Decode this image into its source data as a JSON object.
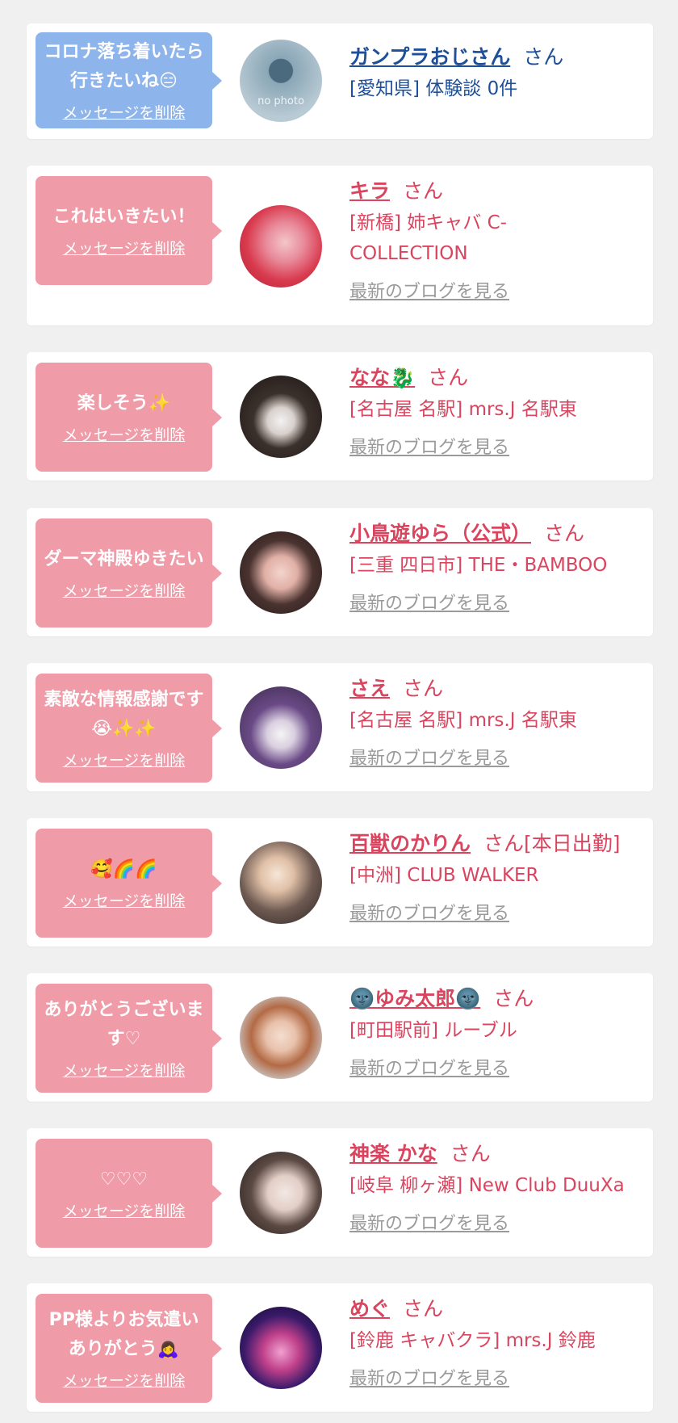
{
  "entries": [
    {
      "message": "コロナ落ち着いたら行きたいね😑",
      "delete_label": "メッセージを削除",
      "name": "ガンプラおじさん",
      "suffix": "さん",
      "detail": "[愛知県] 体験談 0件",
      "avatar_text": "no photo",
      "theme_color": "#8eb4ec"
    },
    {
      "message": "これはいきたい！",
      "delete_label": "メッセージを削除",
      "name": "キラ",
      "suffix": "さん",
      "detail": "[新橋] 姉キャバ C-COLLECTION",
      "blog_label": "最新のブログを見る",
      "theme_color": "#ef9ba8"
    },
    {
      "message": "楽しそう✨",
      "delete_label": "メッセージを削除",
      "name": "なな🐉",
      "suffix": "さん",
      "detail": "[名古屋 名駅] mrs.J 名駅東",
      "blog_label": "最新のブログを見る"
    },
    {
      "message": "ダーマ神殿ゆきたい",
      "delete_label": "メッセージを削除",
      "name": "小鳥遊ゆら（公式）",
      "suffix": "さん",
      "detail": "[三重 四日市] THE・BAMBOO",
      "blog_label": "最新のブログを見る"
    },
    {
      "message": "素敵な情報感謝です😭✨✨",
      "delete_label": "メッセージを削除",
      "name": "さえ",
      "suffix": "さん",
      "detail": "[名古屋 名駅] mrs.J 名駅東",
      "blog_label": "最新のブログを見る"
    },
    {
      "message": "🥰🌈🌈",
      "delete_label": "メッセージを削除",
      "name": "百獣のかりん",
      "suffix": "さん[本日出勤]",
      "detail": "[中洲] CLUB WALKER",
      "blog_label": "最新のブログを見る"
    },
    {
      "message": "ありがとうございます♡",
      "delete_label": "メッセージを削除",
      "name": "🌚ゆみ太郎🌚",
      "suffix": "さん",
      "detail": "[町田駅前] ルーブル",
      "blog_label": "最新のブログを見る"
    },
    {
      "message": "♡♡♡",
      "delete_label": "メッセージを削除",
      "name": "神楽 かな",
      "suffix": "さん",
      "detail": "[岐阜 柳ヶ瀬] New Club DuuXa",
      "blog_label": "最新のブログを見る"
    },
    {
      "message": "PP様よりお気遣いありがとう🙇‍♀️",
      "delete_label": "メッセージを削除",
      "name": "めぐ",
      "suffix": "さん",
      "detail": "[鈴鹿 キャバクラ] mrs.J 鈴鹿",
      "blog_label": "最新のブログを見る"
    }
  ],
  "colors": {
    "accent_pink_text": "#d9455f",
    "accent_blue_text": "#1e4f99",
    "pink_bubble": "#ef9ba8",
    "blue_bubble": "#8eb4ec",
    "background": "#f0f0f0"
  }
}
